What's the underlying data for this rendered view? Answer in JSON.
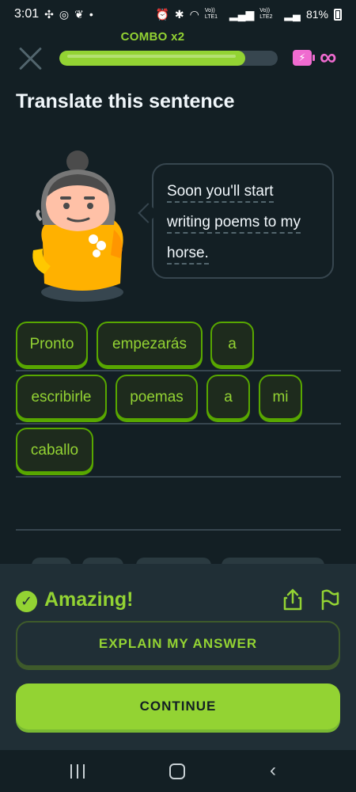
{
  "status_bar": {
    "time": "3:01",
    "battery": "81%",
    "icons": [
      "pinwheel-icon",
      "instagram-icon",
      "owl-icon",
      "dot-icon",
      "alarm-icon",
      "bluetooth-icon",
      "wifi-icon",
      "signal-icon",
      "signal-icon",
      "battery-icon"
    ],
    "network_labels": [
      "Vo)) LTE1",
      "Vo)) LTE2"
    ]
  },
  "header": {
    "combo_label": "COMBO x2",
    "progress": 0.85,
    "energy_icon": "lightning-battery-icon",
    "hearts_icon": "infinity-icon"
  },
  "prompt": {
    "title": "Translate this sentence",
    "sentence_lines": [
      "Soon you'll start",
      "writing poems to my",
      "horse."
    ]
  },
  "answer": {
    "chips": [
      {
        "label": "Pronto"
      },
      {
        "label": "empezarás"
      },
      {
        "label": "a"
      },
      {
        "label": "escribirle"
      },
      {
        "label": "poemas"
      },
      {
        "label": "a"
      },
      {
        "label": "mi"
      },
      {
        "label": "caballo"
      }
    ]
  },
  "feedback": {
    "status": "Amazing!",
    "explain_label": "EXPLAIN MY ANSWER",
    "continue_label": "CONTINUE"
  },
  "colors": {
    "background": "#131f24",
    "accent_green": "#93d333",
    "chip_border": "#58a700",
    "panel": "#202f36",
    "pink": "#f06bd0"
  }
}
